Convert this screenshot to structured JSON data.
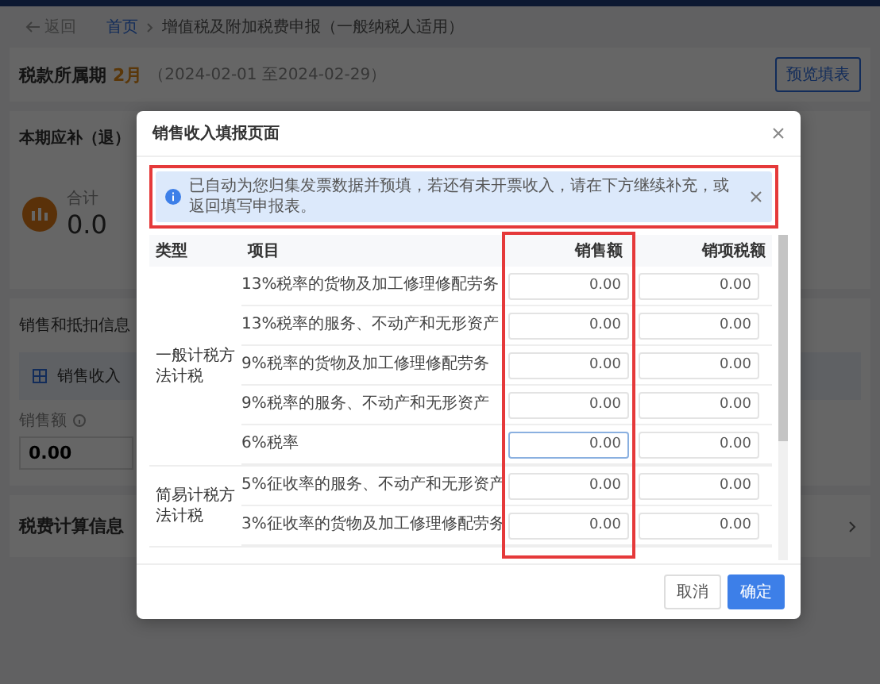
{
  "top_nav": {
    "back": "返回",
    "breadcrumb": [
      {
        "label": "首页",
        "link": true
      },
      {
        "label": "增值税及附加税费申报（一般纳税人适用）",
        "link": false
      }
    ]
  },
  "period": {
    "label": "税款所属期",
    "month": "2月",
    "range": "（2024-02-01 至2024-02-29）",
    "button": "预览填表"
  },
  "summary": {
    "title": "本期应补（退）",
    "total_label": "合计",
    "total_value": "0.0"
  },
  "sales_section": {
    "title": "销售和抵扣信息",
    "banner": "销售收入",
    "field_label": "销售额",
    "field_value": "0.00"
  },
  "tax_section": {
    "title": "税费计算信息"
  },
  "dialog": {
    "title": "销售收入填报页面",
    "alert": "已自动为您归集发票数据并预填，若还有未开票收入，请在下方继续补充，或返回填写申报表。",
    "columns": [
      "类型",
      "项目",
      "销售额",
      "销项税额"
    ],
    "groups": [
      {
        "type": "一般计税方法计税",
        "rows": [
          {
            "item": "13%税率的货物及加工修理修配劳务",
            "sales": "0.00",
            "tax": "0.00",
            "focused": false
          },
          {
            "item": "13%税率的服务、不动产和无形资产",
            "sales": "0.00",
            "tax": "0.00",
            "focused": false
          },
          {
            "item": "9%税率的货物及加工修理修配劳务",
            "sales": "0.00",
            "tax": "0.00",
            "focused": false
          },
          {
            "item": "9%税率的服务、不动产和无形资产",
            "sales": "0.00",
            "tax": "0.00",
            "focused": false
          },
          {
            "item": "6%税率",
            "sales": "0.00",
            "tax": "0.00",
            "focused": true
          }
        ]
      },
      {
        "type": "简易计税方法计税",
        "rows": [
          {
            "item": "5%征收率的服务、不动产和无形资产",
            "sales": "0.00",
            "tax": "0.00",
            "focused": false
          },
          {
            "item": "3%征收率的货物及加工修理修配劳务",
            "sales": "0.00",
            "tax": "0.00",
            "focused": false
          }
        ]
      }
    ],
    "buttons": [
      {
        "label": "取消",
        "primary": false
      },
      {
        "label": "确定",
        "primary": true
      }
    ]
  }
}
